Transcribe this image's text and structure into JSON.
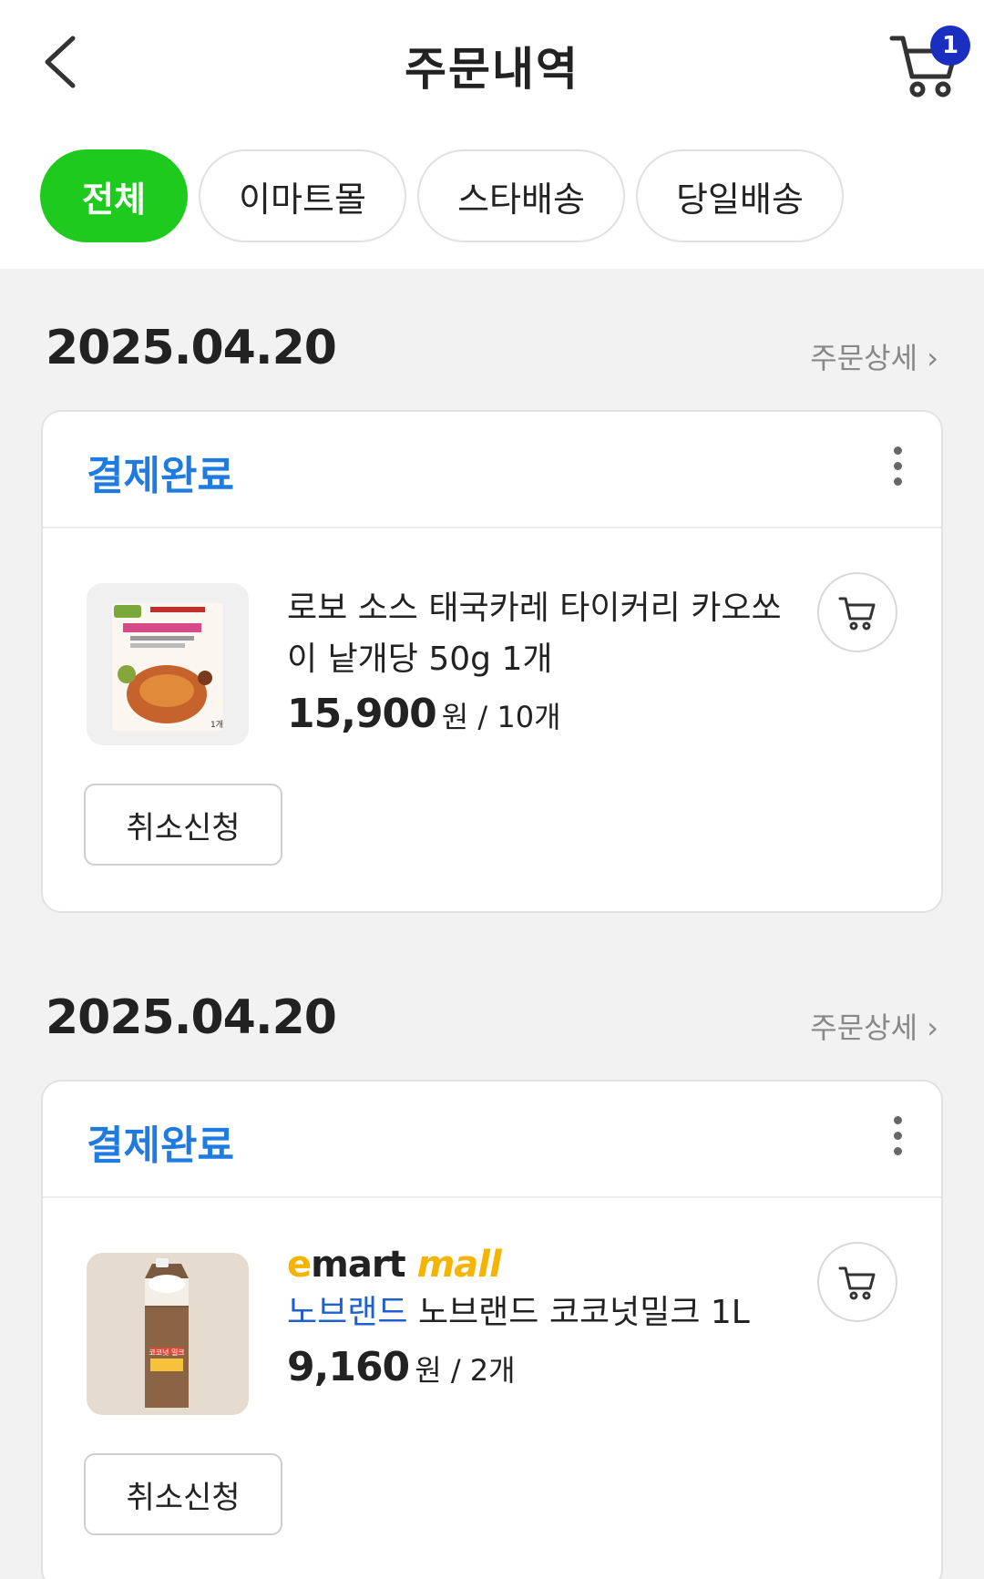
{
  "header": {
    "title": "주문내역",
    "cart_count": "1"
  },
  "filters": [
    {
      "label": "전체",
      "active": true
    },
    {
      "label": "이마트몰",
      "active": false
    },
    {
      "label": "스타배송",
      "active": false
    },
    {
      "label": "당일배송",
      "active": false
    }
  ],
  "orders": [
    {
      "date": "2025.04.20",
      "detail_link": "주문상세 ›",
      "status": "결제완료",
      "item": {
        "name": "로보 소스 태국카레 타이커리 카오쏘이 낱개당 50g 1개",
        "price": "15,900",
        "currency": "원",
        "qty": "/ 10개",
        "thumb_label": "1개"
      },
      "cancel_label": "취소신청"
    },
    {
      "date": "2025.04.20",
      "detail_link": "주문상세 ›",
      "status": "결제완료",
      "item": {
        "brand_logo": {
          "e": "e",
          "mart": "mart",
          "mall": "mall"
        },
        "brand": "노브랜드",
        "name": "노브랜드 코코넛밀크 1L",
        "price": "9,160",
        "currency": "원",
        "qty": "/ 2개",
        "thumb_label": "코코넛 밀크"
      },
      "cancel_label": "취소신청"
    }
  ],
  "colors": {
    "accent_green": "#1fca1f",
    "status_blue": "#1f7be0",
    "badge_blue": "#1a2fbf",
    "brand_blue": "#1f5fcf",
    "emart_yellow": "#f5b400"
  },
  "icons": [
    "back-chevron-icon",
    "cart-icon",
    "more-vertical-icon",
    "add-to-cart-icon"
  ]
}
